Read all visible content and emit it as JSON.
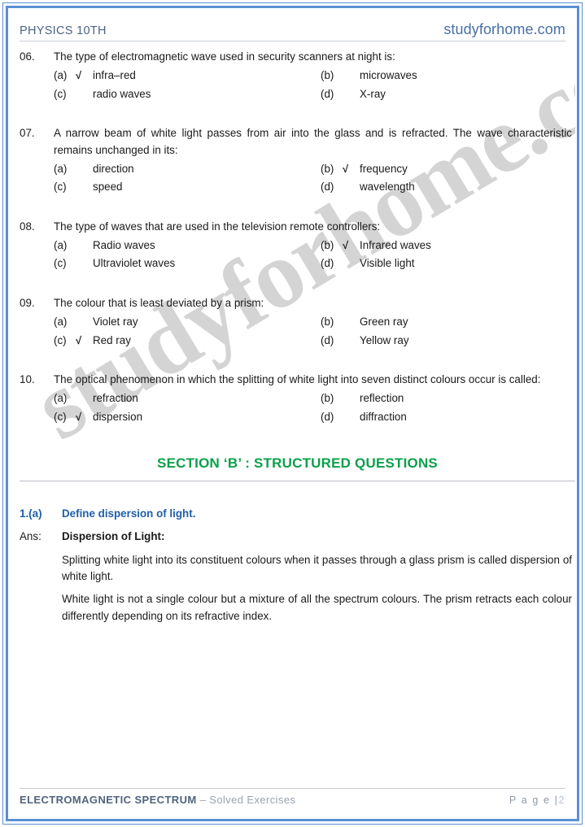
{
  "header": {
    "left_title": "PHYSICS 10TH",
    "right_site": "studyforhome.com"
  },
  "watermark": {
    "text": "studyforhome.com",
    "color": "#d4d4d4"
  },
  "colors": {
    "border": "#5b8fd4",
    "section_green": "#0ca04b",
    "answer_blue": "#1f5fa8",
    "header_blue": "#4a6fa5",
    "footer_bold": "#51637d"
  },
  "mcq": [
    {
      "number": "06.",
      "question": "The type of electromagnetic wave used in security scanners at night is:",
      "options": [
        {
          "label": "(a)",
          "text": "infra–red",
          "checked": true
        },
        {
          "label": "(b)",
          "text": "microwaves",
          "checked": false
        },
        {
          "label": "(c)",
          "text": "radio waves",
          "checked": false
        },
        {
          "label": "(d)",
          "text": "X-ray",
          "checked": false
        }
      ]
    },
    {
      "number": "07.",
      "question": "A narrow beam of white light passes from air into the glass and is refracted. The wave characteristic remains unchanged in its:",
      "options": [
        {
          "label": "(a)",
          "text": "direction",
          "checked": false
        },
        {
          "label": "(b)",
          "text": "frequency",
          "checked": true
        },
        {
          "label": "(c)",
          "text": "speed",
          "checked": false
        },
        {
          "label": "(d)",
          "text": "wavelength",
          "checked": false
        }
      ]
    },
    {
      "number": "08.",
      "question": "The type of waves that are used in the television remote controllers:",
      "options": [
        {
          "label": "(a)",
          "text": "Radio waves",
          "checked": false
        },
        {
          "label": "(b)",
          "text": "Infrared waves",
          "checked": true
        },
        {
          "label": "(c)",
          "text": "Ultraviolet waves",
          "checked": false
        },
        {
          "label": "(d)",
          "text": "Visible light",
          "checked": false
        }
      ]
    },
    {
      "number": "09.",
      "question": "The colour that is least deviated by a prism:",
      "options": [
        {
          "label": "(a)",
          "text": "Violet ray",
          "checked": false
        },
        {
          "label": "(b)",
          "text": "Green ray",
          "checked": false
        },
        {
          "label": "(c)",
          "text": "Red ray",
          "checked": true
        },
        {
          "label": "(d)",
          "text": "Yellow ray",
          "checked": false
        }
      ]
    },
    {
      "number": "10.",
      "question": "The optical phenomenon in which the splitting of white light into seven distinct colours occur is called:",
      "options": [
        {
          "label": "(a)",
          "text": "refraction",
          "checked": false
        },
        {
          "label": "(b)",
          "text": "reflection",
          "checked": false
        },
        {
          "label": "(c)",
          "text": "dispersion",
          "checked": true
        },
        {
          "label": "(d)",
          "text": "diffraction",
          "checked": false
        }
      ]
    }
  ],
  "tick_glyph": "√",
  "section": {
    "title": "SECTION ‘B’ : STRUCTURED QUESTIONS"
  },
  "answer": {
    "question_tag": "1.(a)",
    "question_text": "Define dispersion of light.",
    "answer_tag": "Ans:",
    "answer_heading": "Dispersion of Light:",
    "paragraph_1": "Splitting white light into its constituent colours when it passes through a glass prism is called dispersion of white light.",
    "paragraph_2": "White light is not a single colour but a mixture of all the spectrum colours. The prism retracts each colour differently depending on its refractive index."
  },
  "footer": {
    "title_bold": "ELECTROMAGNETIC SPECTRUM",
    "title_light": " – Solved Exercises",
    "page_label": "P a g e |",
    "page_number": "2"
  }
}
